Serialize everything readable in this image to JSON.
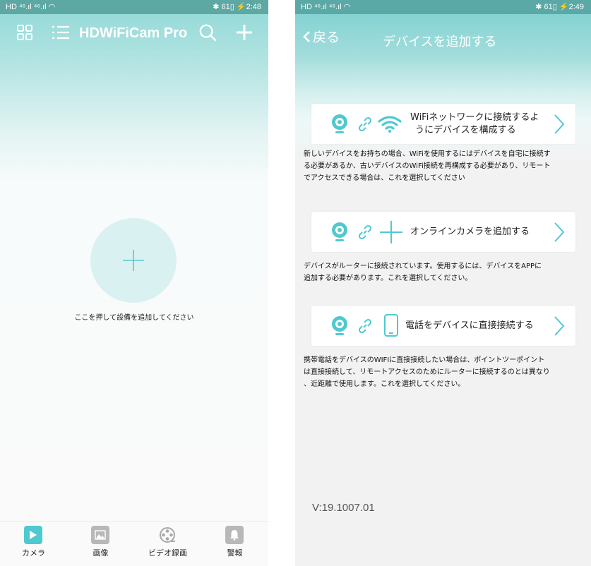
{
  "colors": {
    "accent": "#4fc9d0",
    "header_bg": "#8fd8d6",
    "active_tab": "#4fc9d0",
    "inactive_tab": "#b8b8b8"
  },
  "left": {
    "status": {
      "time": "2:48",
      "battery": "61"
    },
    "app_title": "HDWiFiCam Pro",
    "icons": [
      "grid-icon",
      "list-icon",
      "search-icon",
      "plus-icon"
    ],
    "add_hint": "ここを押して設備を追加してください",
    "tabs": [
      {
        "label": "カメラ",
        "icon": "play-icon",
        "active": true
      },
      {
        "label": "画像",
        "icon": "image-icon",
        "active": false
      },
      {
        "label": "ビデオ録画",
        "icon": "film-reel-icon",
        "active": false
      },
      {
        "label": "警報",
        "icon": "bell-icon",
        "active": false
      }
    ]
  },
  "right": {
    "status": {
      "time": "2:49",
      "battery": "61"
    },
    "back_label": "戻る",
    "title": "デバイスを追加する",
    "options": [
      {
        "label_line1": "WiFiネットワークに接続するよ",
        "label_line2": "うにデバイスを構成する",
        "icons": [
          "camera-icon",
          "link-icon",
          "wifi-icon"
        ],
        "desc": [
          "新しいデバイスをお持ちの場合、WiFiを使用するにはデバイスを自宅に接続す",
          "る必要があるか、古いデバイスのWiFi接続を再構成する必要があり、リモート",
          "でアクセスできる場合は、これを選択してください"
        ]
      },
      {
        "label": "オンラインカメラを追加する",
        "icons": [
          "camera-icon",
          "link-icon",
          "plus-icon"
        ],
        "desc": [
          "デバイスがルーターに接続されています。使用するには、デバイスをAPPに",
          "追加する必要があります。これを選択してください。"
        ]
      },
      {
        "label": "電話をデバイスに直接接続する",
        "icons": [
          "camera-icon",
          "link-icon",
          "phone-icon"
        ],
        "desc": [
          "携帯電話をデバイスのWIFIに直接接続したい場合は、ポイントツーポイント",
          "は直接接続して、リモートアクセスのためにルーターに接続するのとは異なり",
          "、近距離で使用します。これを選択してください。"
        ]
      }
    ],
    "version": "V:19.1007.01"
  }
}
